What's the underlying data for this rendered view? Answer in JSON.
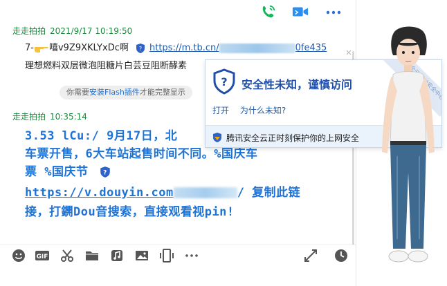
{
  "messages": [
    {
      "sender": "走走拍拍",
      "time": "2021/9/17 10:19:50",
      "prefix": "7-",
      "text_after_emoji": "嘻v9Z9XKLYxDc啊",
      "link_start": "https://m.tb.cn/",
      "link_end": "0fe435",
      "line2": "理想燃料双层微泡阻糖片白芸豆阻断酵素"
    },
    {
      "sender": "走走拍拍",
      "time": "10:35:14",
      "lines": [
        "3.53 lCu:/ 9月17日，北",
        "车票开售，6大车站起售时间不同。%国庆车",
        "票 %国庆节"
      ],
      "link_start": "https://v.douyin.com",
      "link_end": "/ 复制此链",
      "line5": "接，打鐦Dou音搜索，直接观看视pin!"
    }
  ],
  "notice": {
    "prefix": "你需要",
    "flash_link": "安装Flash插件",
    "suffix": "才能完整显示"
  },
  "popup": {
    "title": "安全性未知，谨慎访问",
    "open_label": "打开",
    "why_label": "为什么未知?",
    "footer": "腾讯安全云正时刻保护你的上网安全",
    "ribbon": "腾讯安全云 网址安全中心"
  },
  "colors": {
    "sender_green": "#1a8a3c",
    "link_blue": "#1e5bb0",
    "big_text_blue": "#1e73d6",
    "top_icon_green": "#16b45c",
    "top_icon_blue": "#2a8ff0"
  },
  "toolbar_icons": [
    "emoji-icon",
    "gif-icon",
    "scissors-icon",
    "folder-icon",
    "music-icon",
    "image-icon",
    "screen-share-icon",
    "more-icon",
    "expand-icon",
    "history-clock-icon"
  ]
}
